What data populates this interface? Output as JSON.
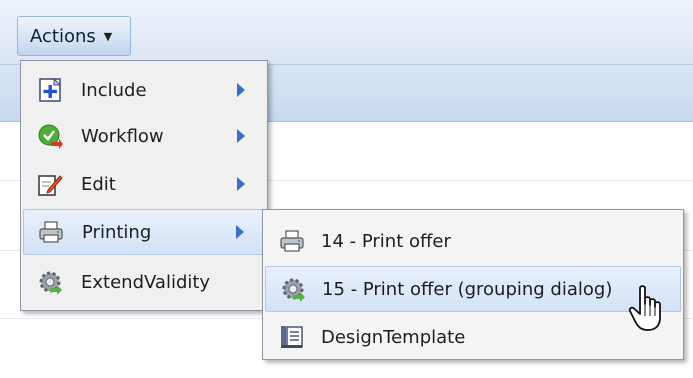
{
  "toolbar": {
    "actions_label": "Actions",
    "actions_caret_icon": "caret-down-icon"
  },
  "main_menu": {
    "items": [
      {
        "label": "Include",
        "icon": "include-add-icon",
        "has_submenu": true
      },
      {
        "label": "Workflow",
        "icon": "workflow-icon",
        "has_submenu": true
      },
      {
        "label": "Edit",
        "icon": "edit-icon",
        "has_submenu": true
      },
      {
        "label": "Printing",
        "icon": "printer-icon",
        "has_submenu": true,
        "highlighted": true
      },
      {
        "label": "ExtendValidity",
        "icon": "gear-icon",
        "has_submenu": false
      }
    ]
  },
  "printing_submenu": {
    "items": [
      {
        "label": "14 - Print offer",
        "icon": "printer-icon"
      },
      {
        "label": "15 - Print offer (grouping dialog)",
        "icon": "gear-icon",
        "highlighted": true
      },
      {
        "label": "DesignTemplate",
        "icon": "design-template-icon"
      }
    ]
  },
  "colors": {
    "highlight": "#d3e2f6",
    "menu_background": "#f0f0f0",
    "submenu_arrow": "#3a6fc4"
  },
  "pointer": "hand-pointer-icon"
}
